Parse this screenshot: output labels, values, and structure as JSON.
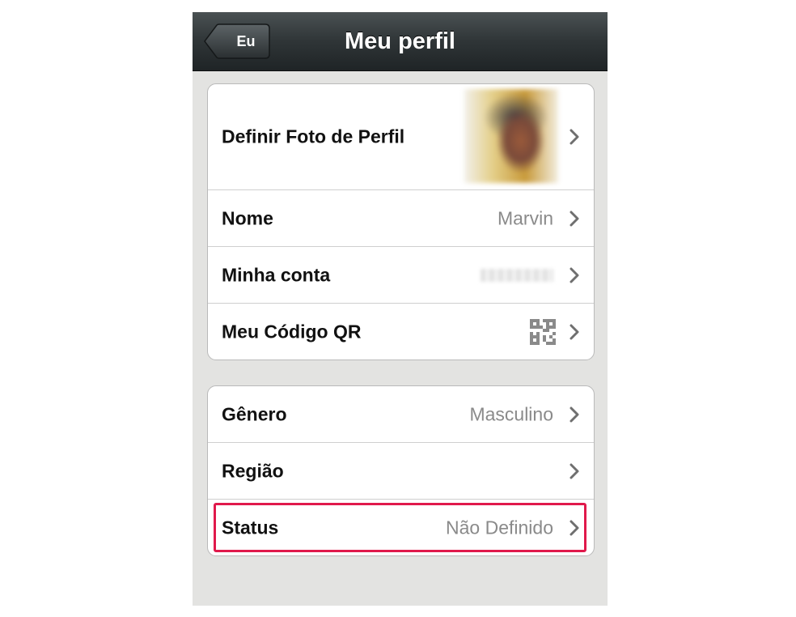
{
  "navbar": {
    "title": "Meu perfil",
    "back_label": "Eu"
  },
  "profile_group": {
    "photo_row": {
      "label": "Definir Foto de Perfil"
    },
    "name_row": {
      "label": "Nome",
      "value": "Marvin"
    },
    "account_row": {
      "label": "Minha conta"
    },
    "qr_row": {
      "label": "Meu Código QR",
      "icon": "qr-code-icon"
    }
  },
  "details_group": {
    "gender_row": {
      "label": "Gênero",
      "value": "Masculino"
    },
    "region_row": {
      "label": "Região"
    },
    "status_row": {
      "label": "Status",
      "value": "Não Definido"
    }
  },
  "colors": {
    "highlight": "#e0194b",
    "navbar": "#2f3537",
    "background": "#e3e3e1"
  }
}
